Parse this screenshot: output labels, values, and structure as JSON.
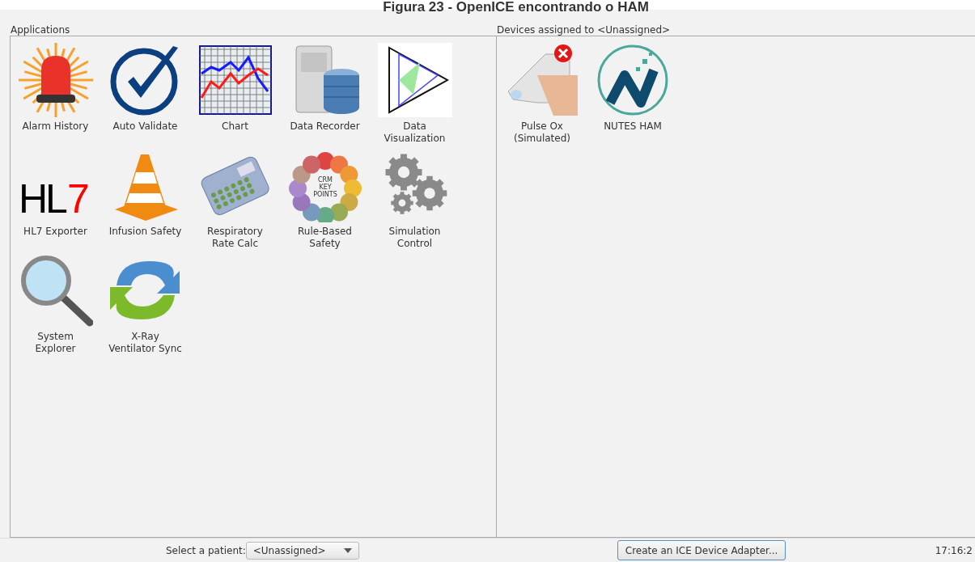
{
  "caption": "Figura 23 - OpenICE encontrando o HAM",
  "applications": {
    "title": "Applications",
    "items": [
      {
        "label": "Alarm History"
      },
      {
        "label": "Auto Validate"
      },
      {
        "label": "Chart"
      },
      {
        "label": "Data Recorder"
      },
      {
        "label": "Data\nVisualization"
      },
      {
        "label": "HL7 Exporter",
        "icon_text": [
          "HL",
          "7"
        ]
      },
      {
        "label": "Infusion Safety"
      },
      {
        "label": "Respiratory\nRate Calc"
      },
      {
        "label": "Rule-Based\nSafety",
        "icon_text": [
          "CRM",
          "KEY",
          "POINTS"
        ]
      },
      {
        "label": "Simulation\nControl"
      },
      {
        "label": "System\nExplorer"
      },
      {
        "label": "X-Ray\nVentilator Sync"
      }
    ]
  },
  "devices": {
    "title": "Devices assigned to <Unassigned>",
    "items": [
      {
        "label": "Pulse Ox\n(Simulated)",
        "error": true
      },
      {
        "label": "NUTES HAM",
        "error": false
      }
    ]
  },
  "footer": {
    "patient_label": "Select a patient:",
    "patient_value": "<Unassigned>",
    "button": "Create an ICE Device Adapter...",
    "time": "17:16:2"
  }
}
